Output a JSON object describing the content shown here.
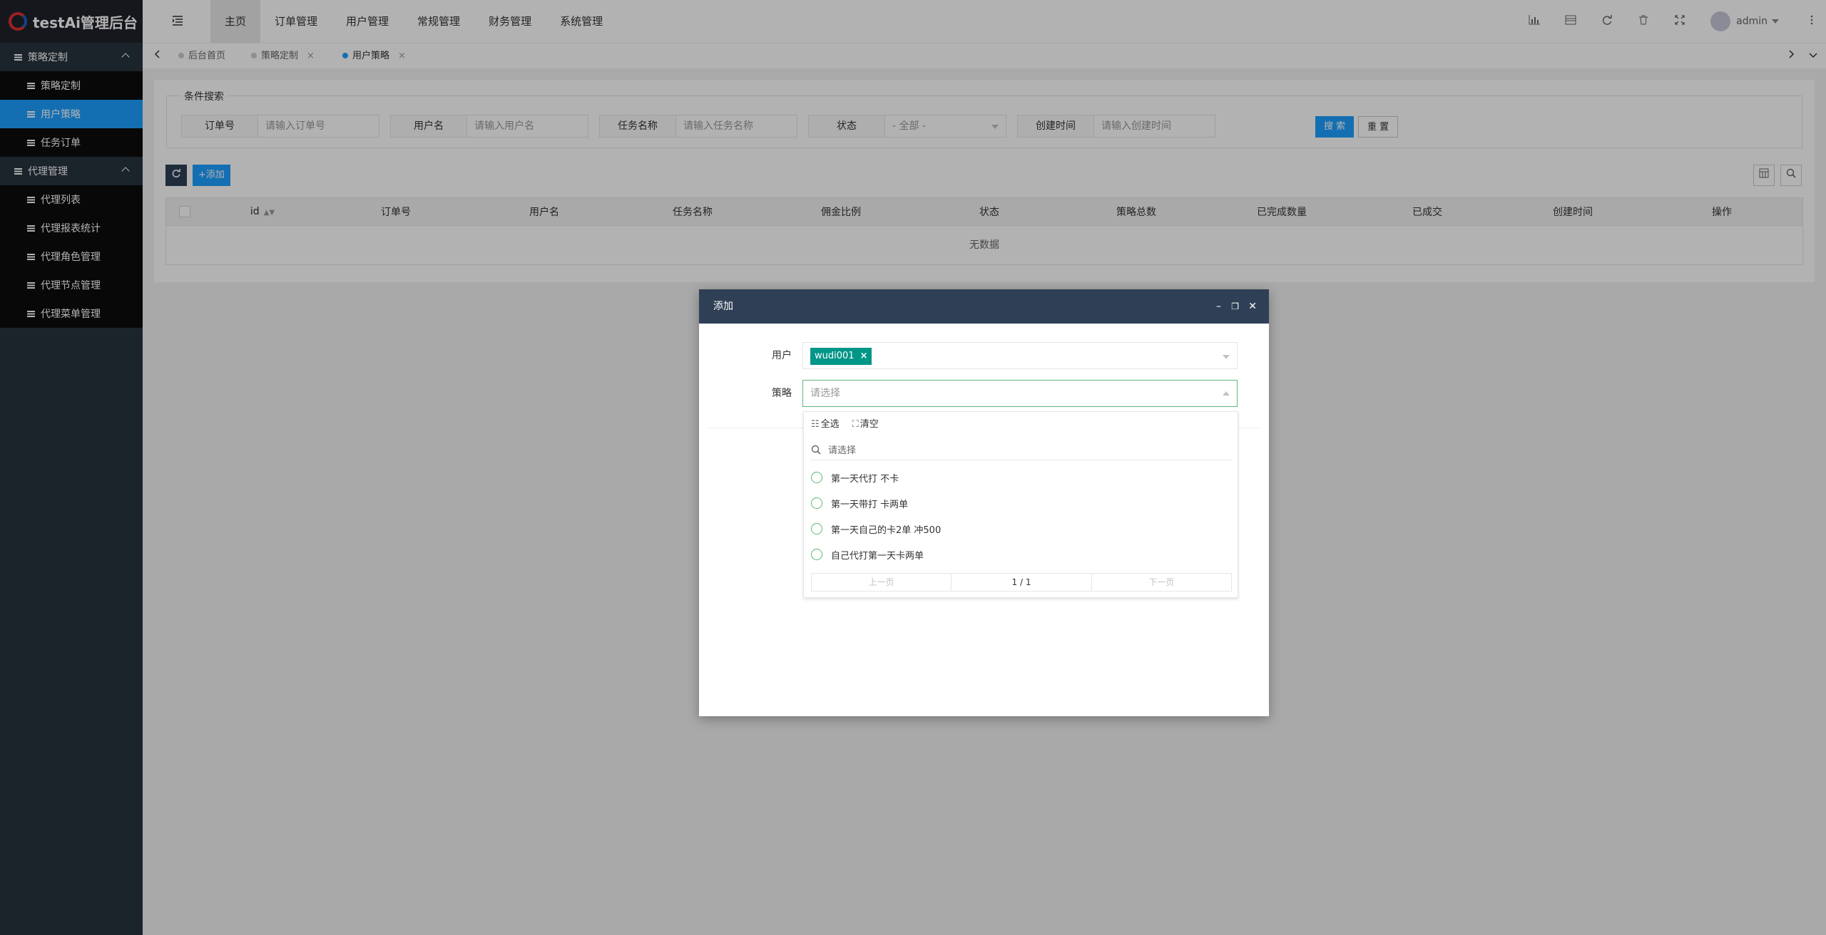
{
  "app": {
    "title": "testAi管理后台"
  },
  "sidebar": {
    "groups": [
      {
        "label": "策略定制",
        "items": [
          "策略定制",
          "用户策略",
          "任务订单"
        ]
      },
      {
        "label": "代理管理",
        "items": [
          "代理列表",
          "代理报表统计",
          "代理角色管理",
          "代理节点管理",
          "代理菜单管理"
        ]
      }
    ],
    "active_item": "用户策略"
  },
  "topnav": {
    "items": [
      "主页",
      "订单管理",
      "用户管理",
      "常规管理",
      "财务管理",
      "系统管理"
    ],
    "active": "主页",
    "user": "admin"
  },
  "tabs": [
    {
      "label": "后台首页",
      "closable": false
    },
    {
      "label": "策略定制",
      "closable": true
    },
    {
      "label": "用户策略",
      "closable": true,
      "active": true
    }
  ],
  "search": {
    "legend": "条件搜索",
    "fields": [
      {
        "label": "订单号",
        "placeholder": "请输入订单号"
      },
      {
        "label": "用户名",
        "placeholder": "请输入用户名"
      },
      {
        "label": "任务名称",
        "placeholder": "请输入任务名称"
      },
      {
        "label": "状态",
        "placeholder": "- 全部 -"
      },
      {
        "label": "创建时间",
        "placeholder": "请输入创建时间"
      }
    ],
    "search_btn": "搜 索",
    "reset_btn": "重 置"
  },
  "toolbar": {
    "add_label": "添加"
  },
  "table": {
    "columns": [
      "id",
      "订单号",
      "用户名",
      "任务名称",
      "佣金比例",
      "状态",
      "策略总数",
      "已完成数量",
      "已成交",
      "创建时间",
      "操作"
    ],
    "empty": "无数据"
  },
  "dialog": {
    "title": "添加",
    "user_label": "用户",
    "user_chip": "wudi001",
    "strategy_label": "策略",
    "strategy_placeholder": "请选择",
    "dropdown": {
      "select_all": "全选",
      "clear": "清空",
      "search_placeholder": "请选择",
      "options": [
        "第一天代打 不卡",
        "第一天带打 卡两单",
        "第一天自己的卡2单 冲500",
        "自己代打第一天卡两单"
      ],
      "prev": "上一页",
      "page": "1 / 1",
      "next": "下一页"
    }
  },
  "colors": {
    "sidebar": "#28333e",
    "logo_bg": "#20222a",
    "active": "#1e9fff",
    "dialog_header": "#2f4056",
    "chip": "#009688",
    "accent_green": "#5fb878"
  }
}
